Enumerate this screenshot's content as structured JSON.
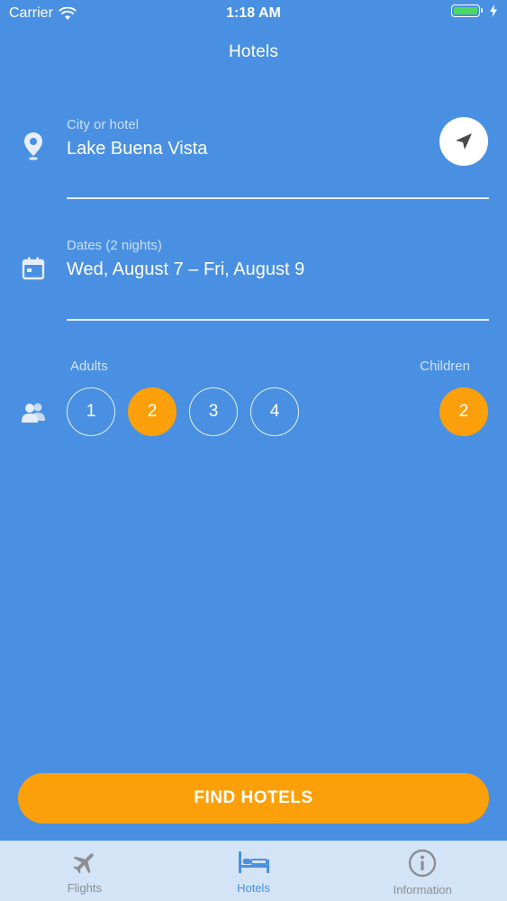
{
  "status_bar": {
    "carrier": "Carrier",
    "time": "1:18 AM",
    "icons": [
      "wifi-icon",
      "battery-icon",
      "charging-bolt-icon"
    ]
  },
  "nav": {
    "title": "Hotels"
  },
  "location": {
    "label": "City or hotel",
    "value": "Lake Buena Vista",
    "icon": "location-pin-icon",
    "locate_icon": "navigation-arrow-icon"
  },
  "dates": {
    "label": "Dates (2 nights)",
    "value": "Wed, August 7 – Fri, August 9",
    "icon": "calendar-icon"
  },
  "guests": {
    "icon": "people-icon",
    "adults_label": "Adults",
    "adults_options": [
      "1",
      "2",
      "3",
      "4"
    ],
    "adults_selected": "2",
    "children_label": "Children",
    "children_value": "2"
  },
  "actions": {
    "find_label": "FIND HOTELS"
  },
  "tabs": [
    {
      "label": "Flights",
      "icon": "airplane-icon",
      "active": false
    },
    {
      "label": "Hotels",
      "icon": "bed-icon",
      "active": true
    },
    {
      "label": "Information",
      "icon": "info-icon",
      "active": false
    }
  ],
  "colors": {
    "background": "#4a90e2",
    "accent": "#fba00a",
    "tab_bar": "#d3e4f7",
    "tab_inactive": "#8e8e93"
  }
}
